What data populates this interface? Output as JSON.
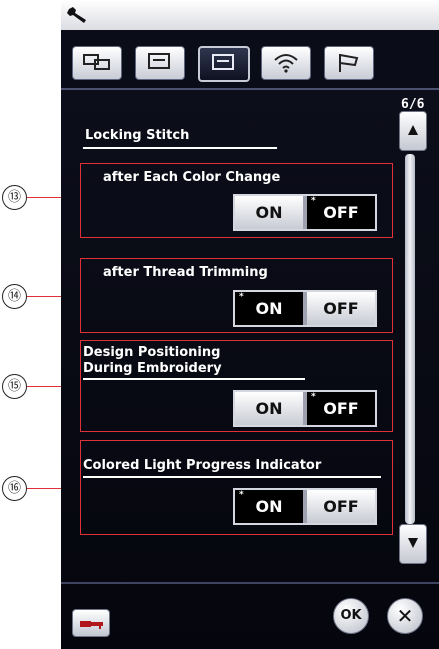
{
  "page_indicator": "6/6",
  "section": {
    "title": "Locking Stitch"
  },
  "settings": [
    {
      "callout": "⑬",
      "label_lines": [
        "after Each Color Change"
      ],
      "on": "ON",
      "off": "OFF",
      "selected": "OFF"
    },
    {
      "callout": "⑭",
      "label_lines": [
        "after Thread Trimming"
      ],
      "on": "ON",
      "off": "OFF",
      "selected": "ON"
    },
    {
      "callout": "⑮",
      "label_lines": [
        "Design Positioning",
        "During Embroidery"
      ],
      "on": "ON",
      "off": "OFF",
      "selected": "OFF"
    },
    {
      "callout": "⑯",
      "label_lines": [
        "Colored Light Progress Indicator"
      ],
      "on": "ON",
      "off": "OFF",
      "selected": "ON"
    }
  ],
  "toggle_marker": "*",
  "tabs": [
    {
      "icon": "sewing-settings-icon"
    },
    {
      "icon": "machine-settings-icon"
    },
    {
      "icon": "embroidery-settings-icon",
      "active": true
    },
    {
      "icon": "wireless-icon"
    },
    {
      "icon": "flag-icon"
    }
  ],
  "buttons": {
    "ok": "OK",
    "close": "✕"
  },
  "colors": {
    "background": "#05060d",
    "highlight_box": "#e0303a",
    "selected_toggle": "#000000"
  }
}
